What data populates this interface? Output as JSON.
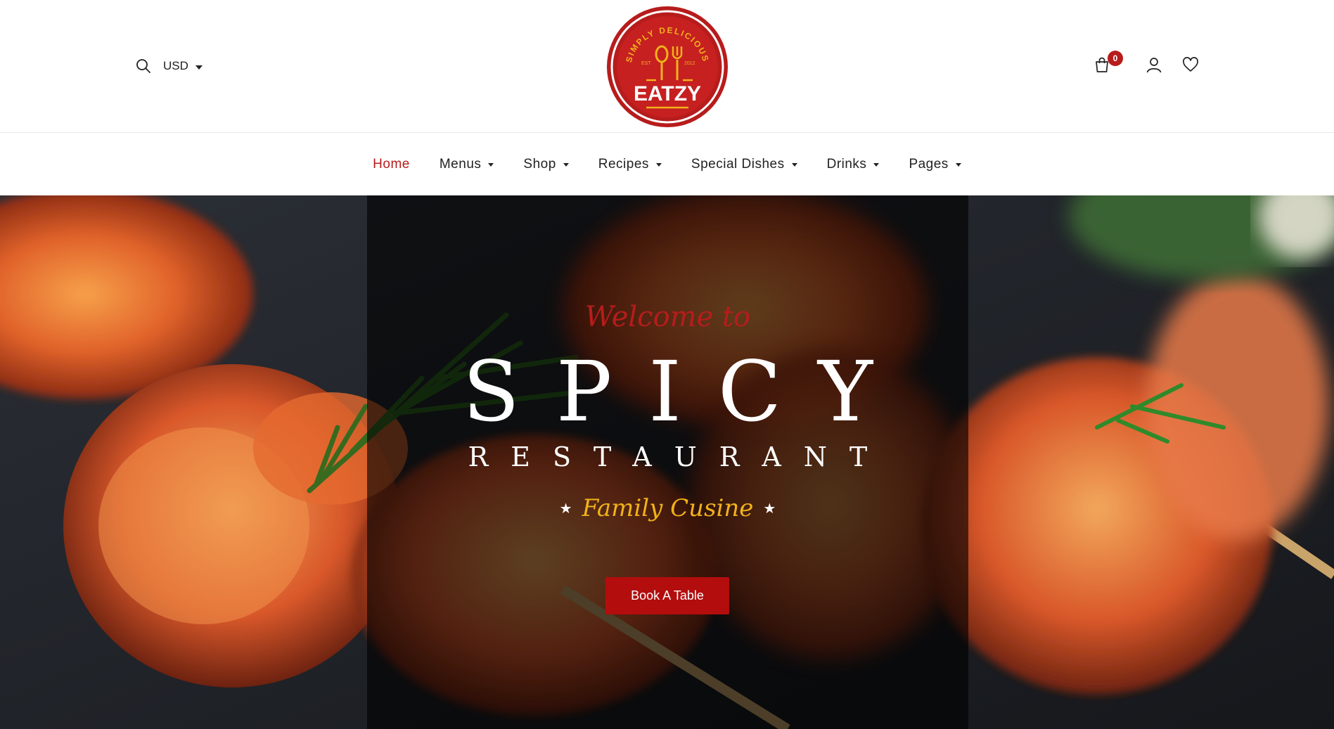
{
  "header": {
    "currency": "USD",
    "logo": {
      "brand": "EATZY",
      "tagline": "SIMPLY DELICIOUS",
      "est_left": "EST",
      "est_right": "2012",
      "color": "#b71c1c",
      "accent": "#f1b21b"
    },
    "cart_count": "0",
    "icons": [
      "search-icon",
      "shopping-bag-icon",
      "user-icon",
      "heart-icon"
    ]
  },
  "nav": {
    "items": [
      {
        "label": "Home",
        "active": true,
        "has_dropdown": false
      },
      {
        "label": "Menus",
        "has_dropdown": true
      },
      {
        "label": "Shop",
        "has_dropdown": true
      },
      {
        "label": "Recipes",
        "has_dropdown": true
      },
      {
        "label": "Special Dishes",
        "has_dropdown": true
      },
      {
        "label": "Drinks",
        "has_dropdown": true
      },
      {
        "label": "Pages",
        "has_dropdown": true
      }
    ]
  },
  "hero": {
    "welcome": "Welcome to",
    "title": "SPICY",
    "subtitle": "RESTAURANT",
    "tagline": "Family Cusine",
    "cta": "Book A Table"
  },
  "colors": {
    "accent_red": "#b71c1c",
    "button_red": "#b30d0d",
    "gold": "#f1b21b"
  }
}
